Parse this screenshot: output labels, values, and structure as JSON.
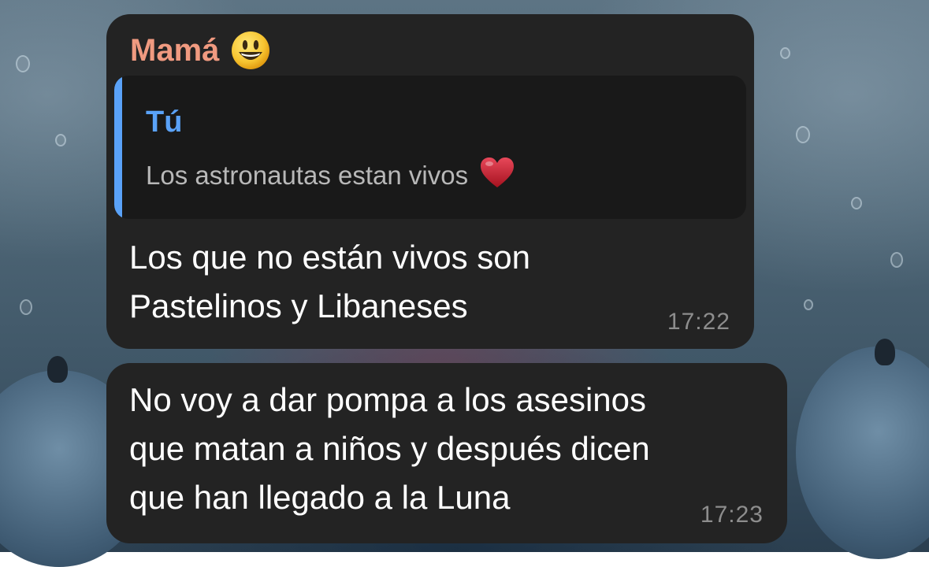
{
  "chat": {
    "messages": [
      {
        "sender": "Mamá",
        "sender_emoji": "smiley-face-emoji",
        "reply": {
          "author": "Tú",
          "text": "Los astronautas estan vivos",
          "emoji": "red-heart-emoji"
        },
        "text_line_1": "Los que no están vivos son",
        "text_line_2": "Pastelinos y Libaneses",
        "time": "17:22"
      },
      {
        "text_line_1": "No voy a dar pompa a los asesinos",
        "text_line_2": "que matan a niños y después dicen",
        "text_line_3": "que han llegado a la Luna",
        "time": "17:23"
      }
    ]
  },
  "colors": {
    "bubble_bg": "#232323",
    "reply_bg": "#191919",
    "sender_name": "#f09a80",
    "reply_accent": "#5aa2f8",
    "timestamp": "#8d8d8d"
  }
}
